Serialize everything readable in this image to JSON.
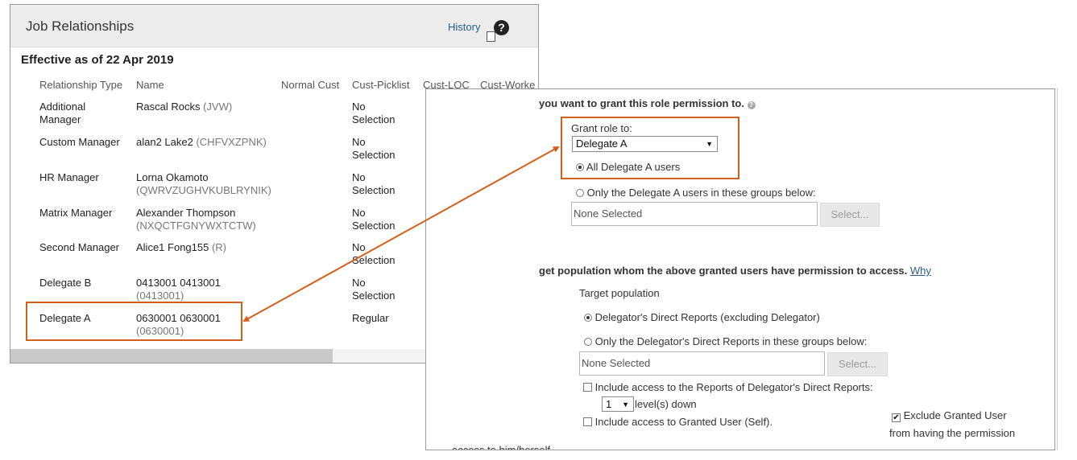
{
  "job_relationships": {
    "title": "Job Relationships",
    "history_label": "History",
    "help_icon": "?",
    "effective": "Effective as of 22 Apr 2019",
    "columns": [
      "Relationship Type",
      "Name",
      "Normal Cust",
      "Cust-Picklist",
      "Cust-LOC",
      "Cust-Worke"
    ],
    "rows": [
      {
        "type_l1": "Additional",
        "type_l2": "Manager",
        "name": "Rascal Rocks",
        "code": "(JVW)",
        "picklist_l1": "No",
        "picklist_l2": "Selection"
      },
      {
        "type_l1": "Custom Manager",
        "type_l2": "",
        "name": "alan2 Lake2",
        "code": "(CHFVXZPNK)",
        "picklist_l1": "No",
        "picklist_l2": "Selection"
      },
      {
        "type_l1": "HR Manager",
        "type_l2": "",
        "name": "Lorna Okamoto",
        "code": "(QWRVZUGHVKUBLRYNIK)",
        "picklist_l1": "No",
        "picklist_l2": "Selection"
      },
      {
        "type_l1": "Matrix Manager",
        "type_l2": "",
        "name": "Alexander Thompson",
        "code": "(NXQCTFGNYWXTCTW)",
        "picklist_l1": "No",
        "picklist_l2": "Selection"
      },
      {
        "type_l1": "Second Manager",
        "type_l2": "",
        "name": "Alice1 Fong155",
        "code": "(R)",
        "picklist_l1": "No",
        "picklist_l2": "Selection"
      },
      {
        "type_l1": "Delegate B",
        "type_l2": "",
        "name": "0413001 0413001",
        "code": "(0413001)",
        "picklist_l1": "No",
        "picklist_l2": "Selection"
      },
      {
        "type_l1": "Delegate A",
        "type_l2": "",
        "name": "0630001 0630001",
        "code": "(0630001)",
        "picklist_l1": "Regular",
        "picklist_l2": ""
      }
    ]
  },
  "permission": {
    "grant_heading": "you want to grant this role permission to.",
    "grant_role_label": "Grant role to:",
    "grant_role_value": "Delegate A",
    "caret": "▼",
    "all_users_label": "All Delegate A users",
    "only_groups_label": "Only the Delegate A users in these groups below:",
    "groups_value": "None Selected",
    "select_button": "Select...",
    "target_heading": "get population whom the above granted users have permission to access.",
    "why_link": "Why",
    "target_population_label": "Target population",
    "direct_reports_label": "Delegator's Direct Reports (excluding Delegator)",
    "only_direct_reports_label": "Only the Delegator's Direct Reports in these groups below:",
    "target_groups_value": "None Selected",
    "target_select_button": "Select...",
    "include_reports_label": "Include access to the Reports of Delegator's Direct Reports:",
    "levels_value": "1",
    "levels_label": "level(s) down",
    "include_self_label": "Include access to Granted User (Self).",
    "exclude_l1": "Exclude Granted User",
    "exclude_l2": "from having the permission",
    "cutoff_text": "access to him/herself",
    "check_mark": "✔",
    "info_icon": "?"
  },
  "colors": {
    "highlight": "#d35f1d",
    "link": "#2a5d8e"
  }
}
